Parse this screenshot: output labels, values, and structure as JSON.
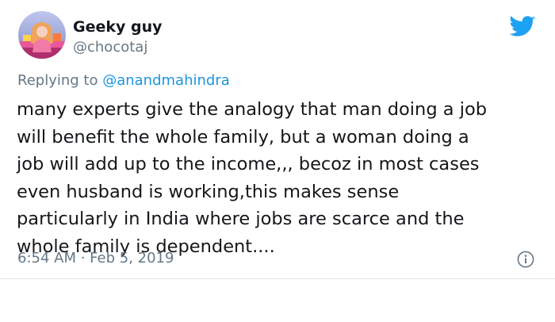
{
  "author": {
    "display_name": "Geeky guy",
    "handle": "@chocotaj"
  },
  "reply": {
    "prefix": "Replying to ",
    "mention": "@anandmahindra"
  },
  "tweet": {
    "text": "many experts give the analogy that man doing a job\nwill benefit the whole family, but a woman doing a\njob will add up to the income,,, becoz in most cases\neven husband is working,this makes sense\nparticularly in India where jobs are scarce and the\nwhole family is dependent....",
    "timestamp": "6:54 AM · Feb 5, 2019"
  },
  "icons": {
    "brand": "twitter-bird-icon",
    "info": "info-icon"
  },
  "colors": {
    "brand_blue": "#1da1f2",
    "link_blue": "#1b95e0",
    "secondary_text": "#657786",
    "divider": "#e1e8ed"
  }
}
